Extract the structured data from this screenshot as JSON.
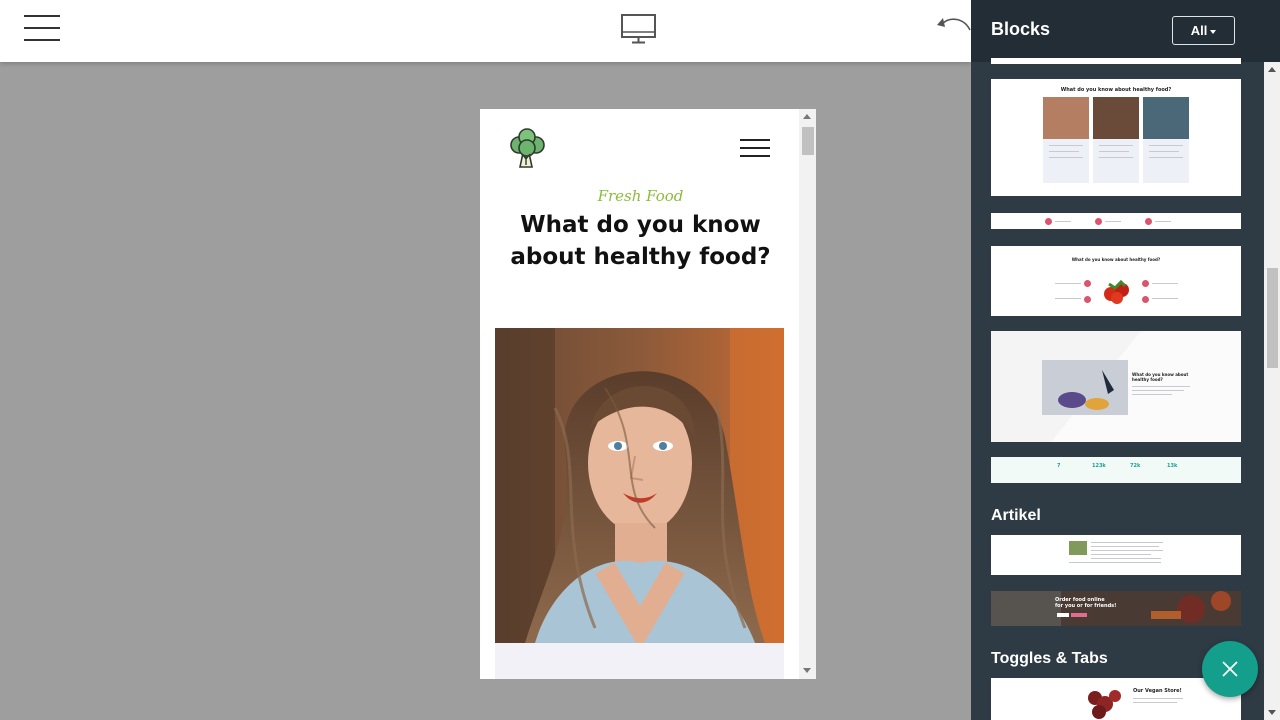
{
  "editor": {
    "menu_icon": "hamburger-icon",
    "device_icon": "desktop-icon",
    "undo_icon": "undo-icon"
  },
  "preview": {
    "logo_icon": "broccoli-logo-icon",
    "menu_icon": "hamburger-icon",
    "eyebrow": "Fresh Food",
    "title": "What do you know about healthy food?",
    "accent_color": "#8cbc3c"
  },
  "sidebar": {
    "title": "Blocks",
    "filter_label": "All",
    "bg_color": "#2e3b44",
    "header_color": "#232d35",
    "thumbnails": {
      "team_title": "What do you know about healthy food?",
      "features_title": "What do you know about healthy food?",
      "promo_title": "What do you know about healthy food?",
      "counters": [
        "7",
        "123k",
        "72k",
        "13k"
      ],
      "order_line1": "Order food online",
      "order_line2": "for you or for friends!",
      "vegan_title": "Our Vegan Store!"
    },
    "sections": {
      "article": "Artikel",
      "toggles": "Toggles & Tabs"
    }
  },
  "fab": {
    "icon": "close-icon",
    "color": "#149e8c"
  }
}
